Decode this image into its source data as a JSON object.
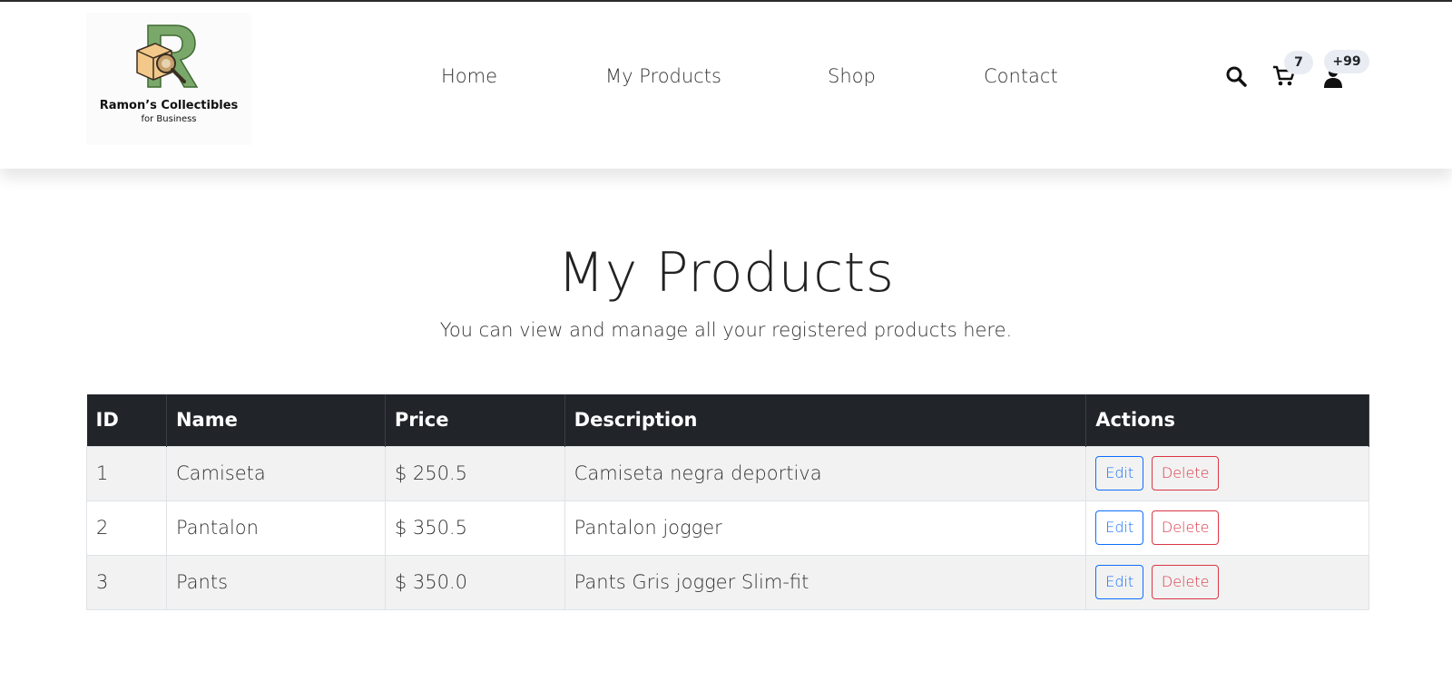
{
  "brand": {
    "name": "Ramon’s Collectibles",
    "tagline": "for Business"
  },
  "nav": {
    "items": [
      "Home",
      "My Products",
      "Shop",
      "Contact"
    ]
  },
  "header_icons": {
    "search": "search-icon",
    "cart": "cart-icon",
    "user": "user-icon",
    "cart_count": "7",
    "notification_count": "+99"
  },
  "hero": {
    "title": "My Products",
    "subtitle": "You can view and manage all your registered products here."
  },
  "products_table": {
    "columns": [
      "ID",
      "Name",
      "Price",
      "Description",
      "Actions"
    ],
    "rows": [
      {
        "id": "1",
        "name": "Camiseta",
        "price": "$ 250.5",
        "description": "Camiseta negra deportiva",
        "edit": "Edit",
        "delete": "Delete"
      },
      {
        "id": "2",
        "name": "Pantalon",
        "price": "$ 350.5",
        "description": "Pantalon jogger",
        "edit": "Edit",
        "delete": "Delete"
      },
      {
        "id": "3",
        "name": "Pants",
        "price": "$ 350.0",
        "description": "Pants Gris jogger Slim-fit",
        "edit": "Edit",
        "delete": "Delete"
      }
    ]
  },
  "colors": {
    "table_header": "#212529",
    "edit_button": "#0d6efd",
    "delete_button": "#dc3545",
    "logo_green": "#7aa86b"
  }
}
